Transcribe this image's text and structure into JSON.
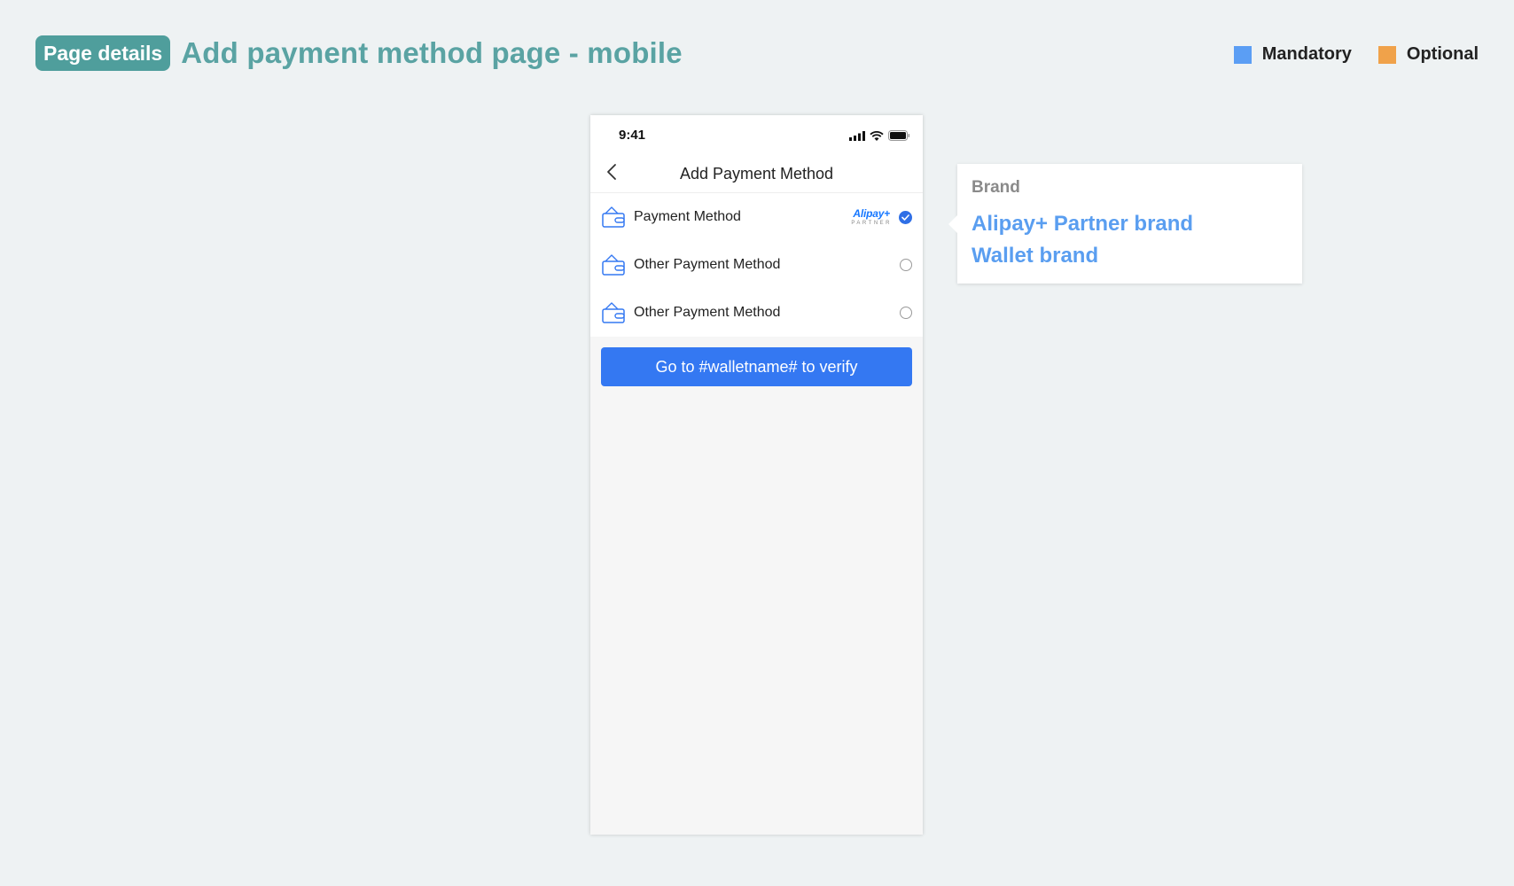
{
  "header": {
    "badge": "Page details",
    "title": "Add payment method page - mobile"
  },
  "legend": [
    {
      "label": "Mandatory",
      "color": "#5b9ef4"
    },
    {
      "label": "Optional",
      "color": "#f0a24a"
    }
  ],
  "phone": {
    "status_time": "9:41",
    "nav_title": "Add Payment Method",
    "payment_methods": [
      {
        "label": "Payment Method",
        "brand_logo": "Alipay+",
        "brand_sub": "PARTNER",
        "selected": true
      },
      {
        "label": "Other Payment Method",
        "selected": false
      },
      {
        "label": "Other Payment Method",
        "selected": false
      }
    ],
    "cta_label": "Go to #walletname# to verify",
    "accent_color": "#3478f2"
  },
  "annotation": {
    "heading": "Brand",
    "lines": [
      "Alipay+ Partner brand",
      "Wallet brand"
    ]
  }
}
